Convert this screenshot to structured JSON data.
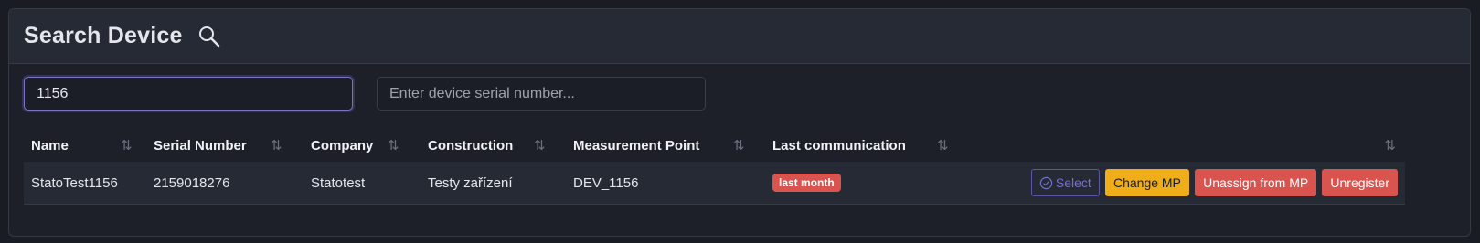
{
  "header": {
    "title": "Search Device",
    "icon": "search-icon"
  },
  "search": {
    "name_value": "1156",
    "serial_placeholder": "Enter device serial number..."
  },
  "table": {
    "columns": [
      "Name",
      "Serial Number",
      "Company",
      "Construction",
      "Measurement Point",
      "Last communication",
      ""
    ],
    "rows": [
      {
        "name": "StatoTest1156",
        "serial": "2159018276",
        "company": "Statotest",
        "construction": "Testy zařízení",
        "measurement_point": "DEV_1156",
        "last_communication": "last month"
      }
    ]
  },
  "actions": {
    "select": "Select",
    "change_mp": "Change MP",
    "unassign": "Unassign from MP",
    "unregister": "Unregister"
  },
  "colors": {
    "accent": "#7570c8",
    "warning": "#f0ad1a",
    "danger": "#d9534f"
  }
}
